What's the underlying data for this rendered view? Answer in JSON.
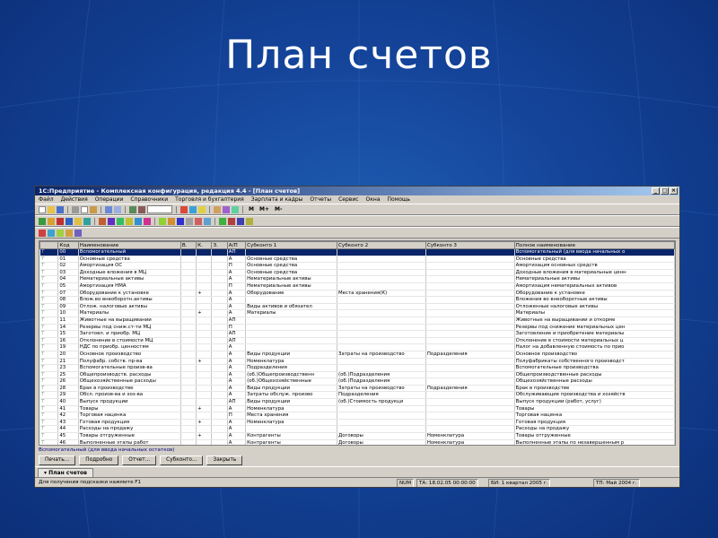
{
  "slide": {
    "title": "План счетов"
  },
  "window": {
    "title": "1С:Предприятие - Комплексная конфигурация, редакция 4.4 - [План счетов]",
    "menu": [
      "Файл",
      "Действия",
      "Операции",
      "Справочники",
      "Торговля и бухгалтерия",
      "Зарплата и кадры",
      "Отчеты",
      "Сервис",
      "Окна",
      "Помощь"
    ],
    "toolbar_text": [
      "М",
      "М+",
      "М-"
    ]
  },
  "table": {
    "columns": [
      "Код",
      "Наименование",
      "В.",
      "К.",
      "З.",
      "А/П",
      "Субконто 1",
      "Субконто 2",
      "Субконто 3",
      "Полное наименование"
    ],
    "rows": [
      [
        "00",
        "Вспомогательный",
        "",
        "",
        "",
        "АП",
        "",
        "",
        "",
        "Вспомогательный (для ввода начальных о"
      ],
      [
        "01",
        "Основные средства",
        "",
        "",
        "",
        "А",
        "Основные средства",
        "",
        "",
        "Основные средства"
      ],
      [
        "02",
        "Амортизация ОС",
        "",
        "",
        "",
        "П",
        "Основные средства",
        "",
        "",
        "Амортизация основных средств"
      ],
      [
        "03",
        "Доходные вложения в МЦ",
        "",
        "",
        "",
        "А",
        "Основные средства",
        "",
        "",
        "Доходные вложения в материальные ценн"
      ],
      [
        "04",
        "Нематериальные активы",
        "",
        "",
        "",
        "А",
        "Нематериальные активы",
        "",
        "",
        "Нематериальные активы"
      ],
      [
        "05",
        "Амортизация НМА",
        "",
        "",
        "",
        "П",
        "Нематериальные активы",
        "",
        "",
        "Амортизация нематериальных активов"
      ],
      [
        "07",
        "Оборудование к установке",
        "",
        "+",
        "",
        "А",
        "Оборудование",
        "Места хранения(К)",
        "",
        "Оборудование к установке"
      ],
      [
        "08",
        "Влож.во внеоборотн.активы",
        "",
        "",
        "",
        "А",
        "",
        "",
        "",
        "Вложения во внеоборотные активы"
      ],
      [
        "09",
        "Отлож. налоговые активы",
        "",
        "",
        "",
        "А",
        "Виды активов и обязател",
        "",
        "",
        "Отложенные налоговые активы"
      ],
      [
        "10",
        "Материалы",
        "",
        "+",
        "",
        "А",
        "Материалы",
        "",
        "",
        "Материалы"
      ],
      [
        "11",
        "Животные на выращивании",
        "",
        "",
        "",
        "АП",
        "",
        "",
        "",
        "Животные на выращивании и откорме"
      ],
      [
        "14",
        "Резервы под сниж.ст-ти МЦ",
        "",
        "",
        "",
        "П",
        "",
        "",
        "",
        "Резервы под снижение материальных цен"
      ],
      [
        "15",
        "Заготовл. и приобр. МЦ",
        "",
        "",
        "",
        "АП",
        "",
        "",
        "",
        "Заготовление и приобретение материалы"
      ],
      [
        "16",
        "Отклонение в стоимости МЦ",
        "",
        "",
        "",
        "АП",
        "",
        "",
        "",
        "Отклонение в стоимости материальных ц"
      ],
      [
        "19",
        "НДС по приобр. ценностям",
        "",
        "",
        "",
        "А",
        "",
        "",
        "",
        "Налог на добавленную стоимость по прио"
      ],
      [
        "20",
        "Основное производство",
        "",
        "",
        "",
        "А",
        "Виды продукции",
        "Затраты на производство",
        "Подразделения",
        "Основное производство"
      ],
      [
        "21",
        "Полуфабр. собств. пр-ва",
        "",
        "+",
        "",
        "А",
        "Номенклатура",
        "",
        "",
        "Полуфабрикаты собственного производст"
      ],
      [
        "23",
        "Вспомогательные произв-ва",
        "",
        "",
        "",
        "А",
        "Подразделения",
        "",
        "",
        "Вспомогательные производства"
      ],
      [
        "25",
        "Общепроизводств. расходы",
        "",
        "",
        "",
        "А",
        "(об.)Общепроизводственн",
        "(об.)Подразделения",
        "",
        "Общепроизводственные расходы"
      ],
      [
        "26",
        "Общехозяйственные расходы",
        "",
        "",
        "",
        "А",
        "(об.)Общехозяйственные",
        "(об.)Подразделения",
        "",
        "Общехозяйственные расходы"
      ],
      [
        "28",
        "Брак в производстве",
        "",
        "",
        "",
        "А",
        "Виды продукции",
        "Затраты на производство",
        "Подразделения",
        "Брак в производстве"
      ],
      [
        "29",
        "Обсл. произв-ва и хоз-ва",
        "",
        "",
        "",
        "А",
        "Затраты обслуж. произво",
        "Подразделения",
        "",
        "Обслуживающие производства и хозяйств"
      ],
      [
        "40",
        "Выпуск продукции",
        "",
        "",
        "",
        "АП",
        "Виды продукции",
        "(об.)Стоимость продукци",
        "",
        "Выпуск продукции (работ, услуг)"
      ],
      [
        "41",
        "Товары",
        "",
        "+",
        "",
        "А",
        "Номенклатура",
        "",
        "",
        "Товары"
      ],
      [
        "42",
        "Торговая наценка",
        "",
        "",
        "",
        "П",
        "Места хранения",
        "",
        "",
        "Торговая наценка"
      ],
      [
        "43",
        "Готовая продукция",
        "",
        "+",
        "",
        "А",
        "Номенклатура",
        "",
        "",
        "Готовая продукция"
      ],
      [
        "44",
        "Расходы на продажу",
        "",
        "",
        "",
        "А",
        "",
        "",
        "",
        "Расходы на продажу"
      ],
      [
        "45",
        "Товары отгруженные",
        "",
        "+",
        "",
        "А",
        "Контрагенты",
        "Договоры",
        "Номенклатура",
        "Товары отгруженные"
      ],
      [
        "46",
        "Выполненные этапы работ",
        "",
        "",
        "",
        "А",
        "Контрагенты",
        "Договоры",
        "Номенклатура",
        "Выполненные этапы по незавершенным р"
      ],
      [
        "50",
        "Касса",
        "",
        "",
        "",
        "А",
        "",
        "",
        "",
        "Касса"
      ],
      [
        "51",
        "Расчетные счета",
        "",
        "",
        "",
        "А",
        "Банковские счета",
        "(об.)Движения денежных с",
        "",
        "Расчетные счета"
      ],
      [
        "52",
        "Валютные счета",
        "",
        "+",
        "",
        "А",
        "Банковские счета",
        "(об.)Движения денежных с",
        "",
        "Валютные счета"
      ]
    ]
  },
  "description": "Вспомогательный (для ввода начальных остатков)",
  "buttons": [
    "Печать...",
    "Подробно",
    "Отчет...",
    "Субконто...",
    "Закрыть"
  ],
  "taskbar": {
    "tab": "План счетов"
  },
  "status": {
    "hint": "Для получения подсказки нажмите F1",
    "num": "NUM",
    "ta": "ТА: 18.02.05  00:00:00",
    "bi": "БИ: 1 квартал 2005 г.",
    "tp": "ТП: Май 2004 г."
  }
}
